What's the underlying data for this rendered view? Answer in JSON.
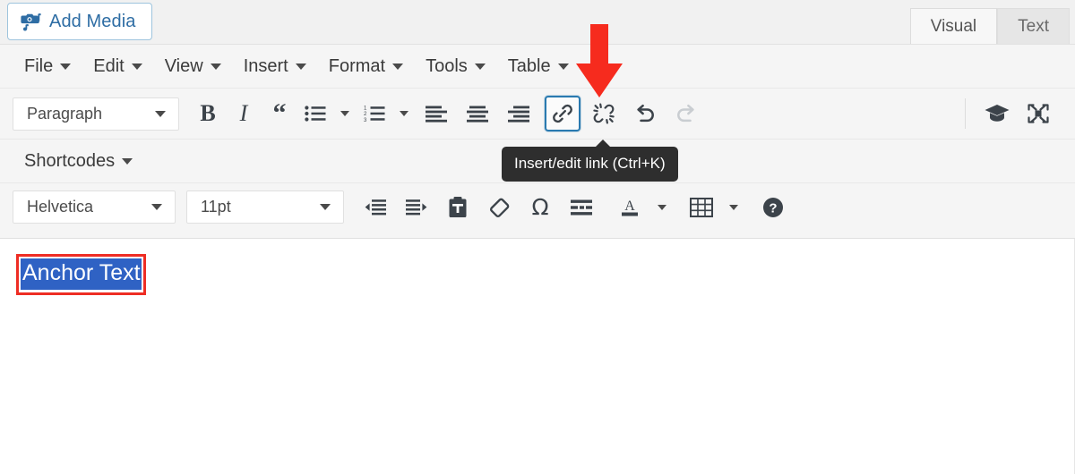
{
  "media_bar": {
    "add_media_label": "Add Media",
    "add_media_icon": "media-camera-note-icon",
    "tabs": [
      {
        "label": "Visual",
        "active": true
      },
      {
        "label": "Text",
        "active": false
      }
    ]
  },
  "menu_bar": {
    "items": [
      {
        "label": "File"
      },
      {
        "label": "Edit"
      },
      {
        "label": "View"
      },
      {
        "label": "Insert"
      },
      {
        "label": "Format"
      },
      {
        "label": "Tools"
      },
      {
        "label": "Table"
      }
    ]
  },
  "format_bar": {
    "block_format": "Paragraph",
    "buttons": [
      {
        "name": "bold-button",
        "glyph": "B"
      },
      {
        "name": "italic-button",
        "glyph": "I"
      },
      {
        "name": "blockquote-button",
        "glyph": "“"
      },
      {
        "name": "bullet-list-button",
        "glyph": "bullet-list-icon"
      },
      {
        "name": "numbered-list-button",
        "glyph": "numbered-list-icon"
      },
      {
        "name": "align-left-button",
        "glyph": "align-left-icon"
      },
      {
        "name": "align-center-button",
        "glyph": "align-center-icon"
      },
      {
        "name": "align-right-button",
        "glyph": "align-right-icon"
      },
      {
        "name": "insert-link-button",
        "glyph": "link-icon"
      },
      {
        "name": "unlink-button",
        "glyph": "broken-link-icon"
      },
      {
        "name": "undo-button",
        "glyph": "undo-icon"
      },
      {
        "name": "redo-button",
        "glyph": "redo-icon"
      }
    ],
    "right_buttons": [
      {
        "name": "keyboard-shortcuts-button",
        "glyph": "graduation-cap-icon"
      },
      {
        "name": "fullscreen-button",
        "glyph": "expand-arrows-icon"
      }
    ]
  },
  "shortcodes_bar": {
    "label": "Shortcodes"
  },
  "font_bar": {
    "font_name": "Helvetica",
    "font_size": "11pt",
    "buttons": [
      {
        "name": "decrease-indent-button",
        "glyph": "outdent-icon"
      },
      {
        "name": "increase-indent-button",
        "glyph": "indent-icon"
      },
      {
        "name": "paste-as-text-button",
        "glyph": "clipboard-text-icon"
      },
      {
        "name": "clear-formatting-button",
        "glyph": "eraser-icon"
      },
      {
        "name": "special-character-button",
        "glyph": "omega-icon"
      },
      {
        "name": "read-more-button",
        "glyph": "read-more-icon"
      },
      {
        "name": "text-color-button",
        "glyph": "text-color-icon"
      },
      {
        "name": "table-button",
        "glyph": "table-grid-icon"
      },
      {
        "name": "help-button",
        "glyph": "question-circle-icon"
      }
    ]
  },
  "tooltip": {
    "text": "Insert/edit link (Ctrl+K)"
  },
  "annotation": {
    "arrow": "red-down-arrow",
    "highlight_box": "red-rectangle-highlight"
  },
  "content": {
    "selected_text": "Anchor Text"
  },
  "colors": {
    "accent_blue": "#2e6da4",
    "focus_blue": "#2a7ab0",
    "selection_blue": "#2f62c4",
    "annotation_red": "#ee2d24",
    "toolbar_bg": "#f5f5f5",
    "tooltip_bg": "#2e2e2e"
  }
}
